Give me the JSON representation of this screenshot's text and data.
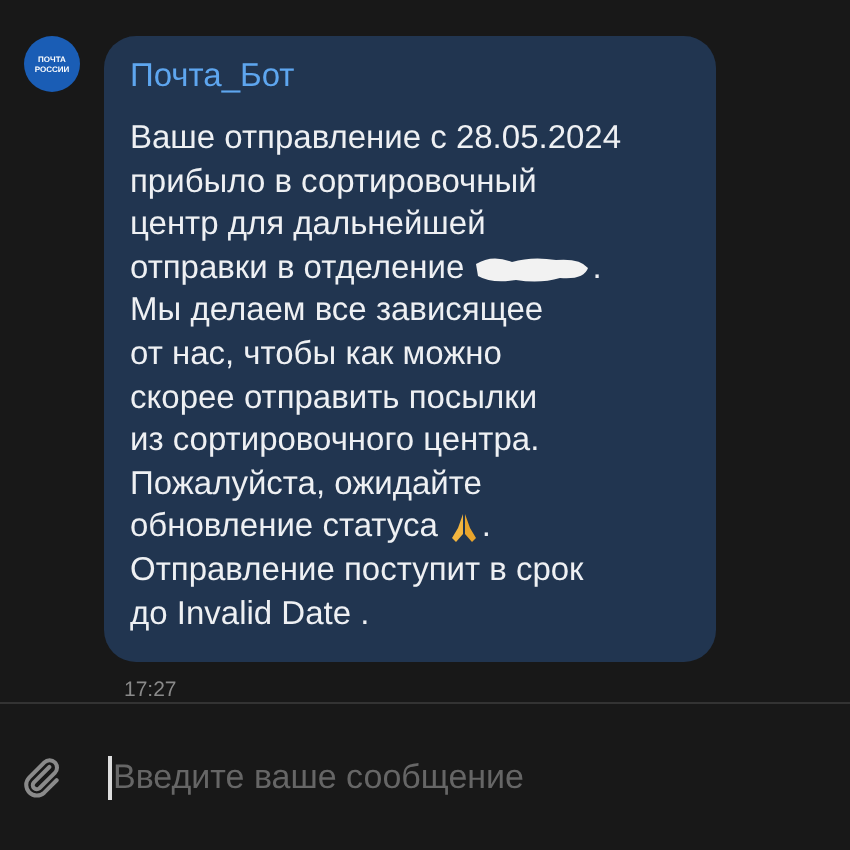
{
  "avatar": {
    "lines": [
      "ПОЧТА",
      "РОССИИ"
    ]
  },
  "message": {
    "sender": "Почта_Бот",
    "lines": [
      [
        {
          "kind": "text",
          "text": "Ваше отправление с 28.05.2024"
        }
      ],
      [
        {
          "kind": "text",
          "text": "прибыло в сортировочный"
        }
      ],
      [
        {
          "kind": "text",
          "text": "центр для дальнейшей"
        }
      ],
      [
        {
          "kind": "text",
          "text": "отправки в отделение"
        },
        {
          "kind": "redaction"
        },
        {
          "kind": "text",
          "text": "."
        }
      ],
      [
        {
          "kind": "text",
          "text": "Мы делаем все зависящее"
        }
      ],
      [
        {
          "kind": "text",
          "text": "от нас, чтобы как можно"
        }
      ],
      [
        {
          "kind": "text",
          "text": "скорее отправить посылки"
        }
      ],
      [
        {
          "kind": "text",
          "text": "из сортировочного центра."
        }
      ],
      [
        {
          "kind": "text",
          "text": "Пожалуйста, ожидайте"
        }
      ],
      [
        {
          "kind": "text",
          "text": "обновление статуса"
        },
        {
          "kind": "emoji"
        },
        {
          "kind": "text",
          "text": "."
        }
      ],
      [
        {
          "kind": "text",
          "text": "Отправление поступит в срок"
        }
      ],
      [
        {
          "kind": "text",
          "text": "до Invalid Date ."
        }
      ]
    ],
    "time": "17:27"
  },
  "composer": {
    "placeholder": "Введите ваше сообщение"
  }
}
